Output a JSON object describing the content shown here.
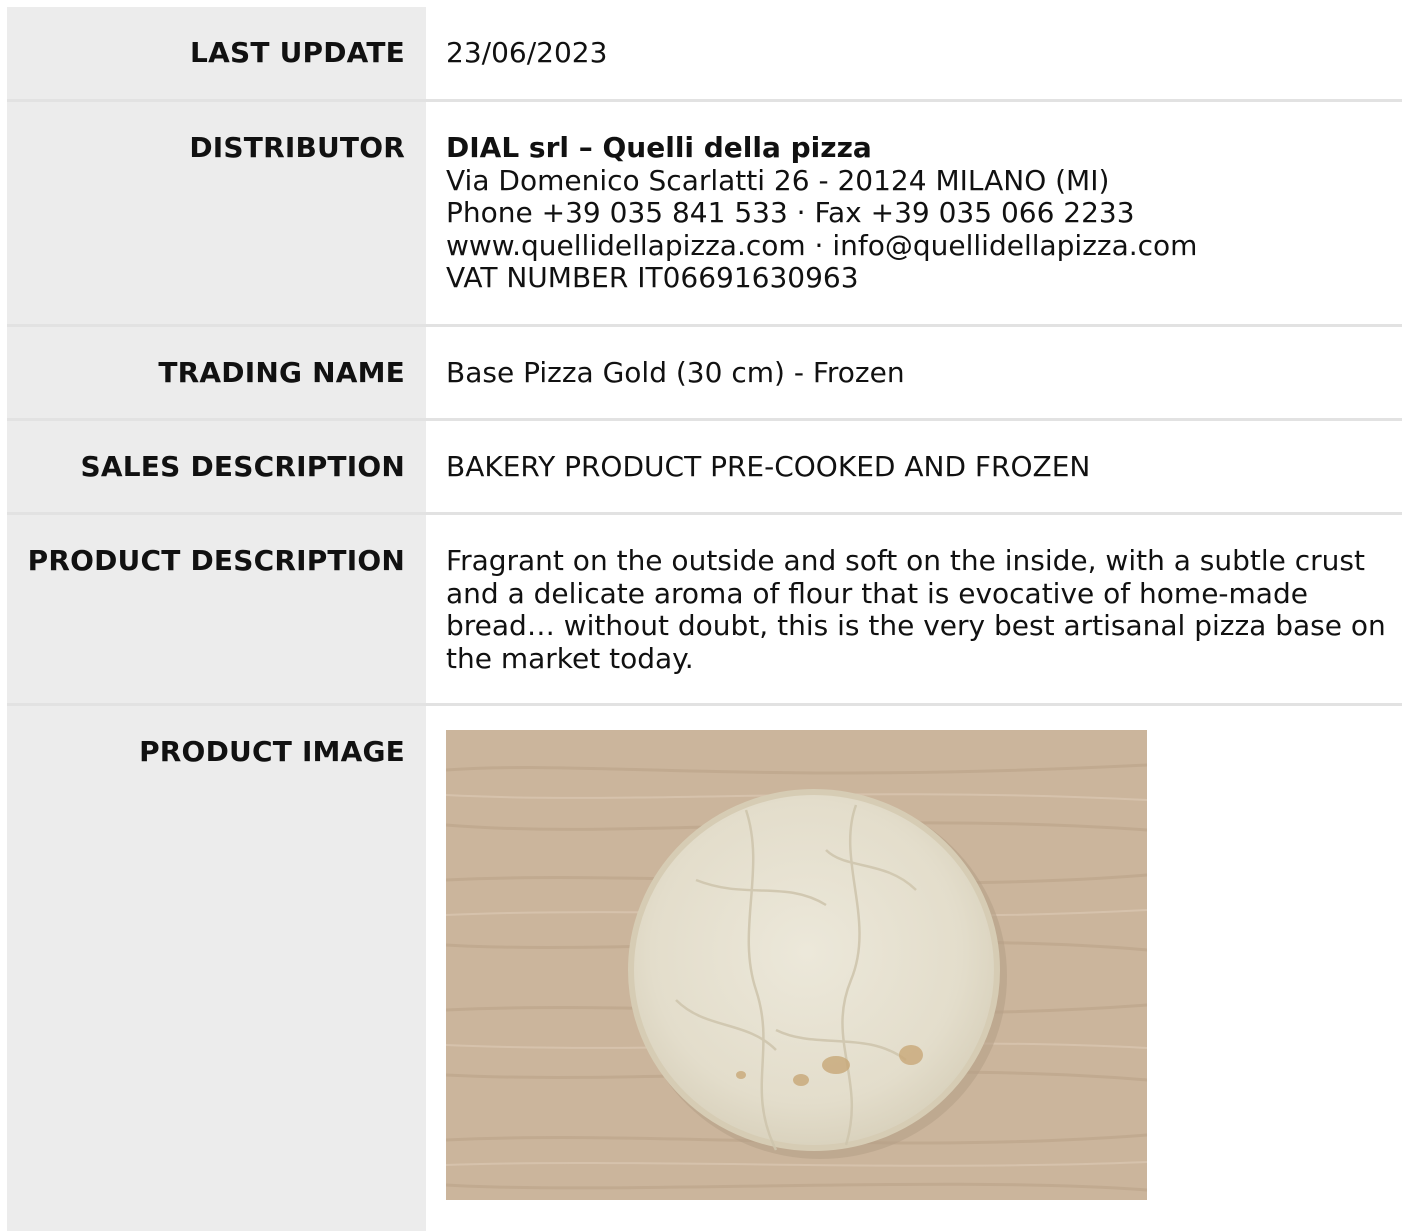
{
  "rows": {
    "last_update": {
      "label": "LAST UPDATE",
      "value": "23/06/2023"
    },
    "distributor": {
      "label": "DISTRIBUTOR",
      "name": "DIAL srl – Quelli della pizza",
      "address": "Via Domenico Scarlatti 26 - 20124 MILANO (MI)",
      "contacts": "Phone +39 035 841 533 · Fax +39 035 066 2233",
      "web": "www.quellidellapizza.com · info@quellidellapizza.com",
      "vat": "VAT NUMBER IT06691630963"
    },
    "trading_name": {
      "label": "TRADING NAME",
      "value": "Base Pizza Gold (30 cm) - Frozen"
    },
    "sales_description": {
      "label": "SALES DESCRIPTION",
      "value": "BAKERY PRODUCT PRE-COOKED AND FROZEN"
    },
    "product_description": {
      "label": "PRODUCT DESCRIPTION",
      "value": "Fragrant on the outside and soft on the inside, with a subtle crust and a delicate aroma of flour that is evocative of home-made bread… without doubt, this is the very best artisanal pizza base on the market today."
    },
    "product_image": {
      "label": "PRODUCT IMAGE",
      "image": "pizza-base-photo"
    }
  },
  "colors": {
    "label_bg": "#ececec",
    "divider": "#e2e2e2",
    "wood": "#cbb59c",
    "dough": "#e7e2d3"
  }
}
